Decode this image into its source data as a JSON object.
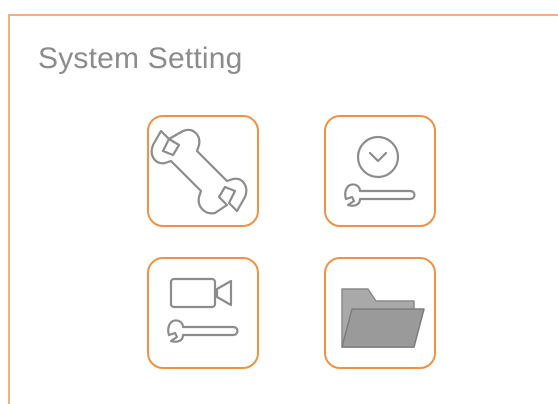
{
  "window": {
    "title": "System Setting"
  },
  "tiles": [
    {
      "icon": "wrench-icon",
      "label": ""
    },
    {
      "icon": "clock-wrench-icon",
      "label": ""
    },
    {
      "icon": "camera-wrench-icon",
      "label": ""
    },
    {
      "icon": "folder-icon",
      "label": ""
    }
  ],
  "colors": {
    "border": "#f4b07a",
    "accent": "#f2913f",
    "icon_stroke": "#8c8c8c",
    "folder_fill": "#a9a9a9",
    "title_text": "#8c8c8c"
  }
}
